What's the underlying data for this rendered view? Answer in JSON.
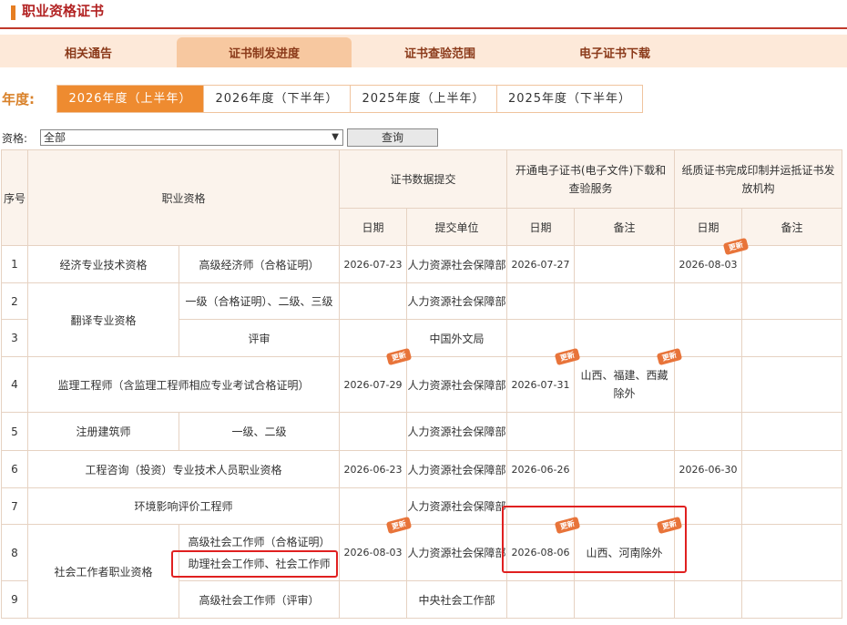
{
  "page": {
    "title": "职业资格证书"
  },
  "tabs": [
    "相关通告",
    "证书制发进度",
    "证书查验范围",
    "电子证书下载"
  ],
  "year_label": "年度:",
  "years": [
    "2026年度（上半年）",
    "2026年度（下半年）",
    "2025年度（上半年）",
    "2025年度（下半年）"
  ],
  "filter": {
    "label": "资格:",
    "value": "全部",
    "button": "查询"
  },
  "headers": {
    "seq": "序号",
    "qual": "职业资格",
    "g1": "证书数据提交",
    "g2": "开通电子证书(电子文件)下载和查验服务",
    "g3": "纸质证书完成印制并运抵证书发放机构",
    "date": "日期",
    "unit": "提交单位",
    "note": "备注"
  },
  "badge": "更新",
  "rows": [
    {
      "seq": "1",
      "cat": "经济专业技术资格",
      "sub": "高级经济师（合格证明）",
      "d1": "2026-07-23",
      "unit": "人力资源社会保障部",
      "d2": "2026-07-27",
      "n2": "",
      "d3": "2026-08-03",
      "n3": ""
    },
    {
      "seq": "2",
      "cat": "翻译专业资格",
      "sub": "一级（合格证明）、二级、三级",
      "d1": "",
      "unit": "人力资源社会保障部",
      "d2": "",
      "n2": "",
      "d3": "",
      "n3": ""
    },
    {
      "seq": "3",
      "cat": "",
      "sub": "评审",
      "d1": "",
      "unit": "中国外文局",
      "d2": "",
      "n2": "",
      "d3": "",
      "n3": ""
    },
    {
      "seq": "4",
      "cat": "监理工程师（含监理工程师相应专业考试合格证明）",
      "sub": "",
      "d1": "2026-07-29",
      "unit": "人力资源社会保障部",
      "d2": "2026-07-31",
      "n2": "山西、福建、西藏除外",
      "d3": "",
      "n3": ""
    },
    {
      "seq": "5",
      "cat": "注册建筑师",
      "sub": "一级、二级",
      "d1": "",
      "unit": "人力资源社会保障部",
      "d2": "",
      "n2": "",
      "d3": "",
      "n3": ""
    },
    {
      "seq": "6",
      "cat": "工程咨询（投资）专业技术人员职业资格",
      "sub": "",
      "d1": "2026-06-23",
      "unit": "人力资源社会保障部",
      "d2": "2026-06-26",
      "n2": "",
      "d3": "2026-06-30",
      "n3": ""
    },
    {
      "seq": "7",
      "cat": "环境影响评价工程师",
      "sub": "",
      "d1": "",
      "unit": "人力资源社会保障部",
      "d2": "",
      "n2": "",
      "d3": "",
      "n3": ""
    },
    {
      "seq": "8",
      "cat": "社会工作者职业资格",
      "sub": "高级社会工作师（合格证明）",
      "sub2": "助理社会工作师、社会工作师",
      "d1": "2026-08-03",
      "unit": "人力资源社会保障部",
      "d2": "2026-08-06",
      "n2": "山西、河南除外",
      "d3": "",
      "n3": ""
    },
    {
      "seq": "9",
      "cat": "",
      "sub": "高级社会工作师（评审）",
      "d1": "",
      "unit": "中央社会工作部",
      "d2": "",
      "n2": "",
      "d3": "",
      "n3": ""
    }
  ],
  "colors": {
    "accent": "#ee8b30",
    "badge": "#e8743a",
    "highlight": "#e02020"
  }
}
